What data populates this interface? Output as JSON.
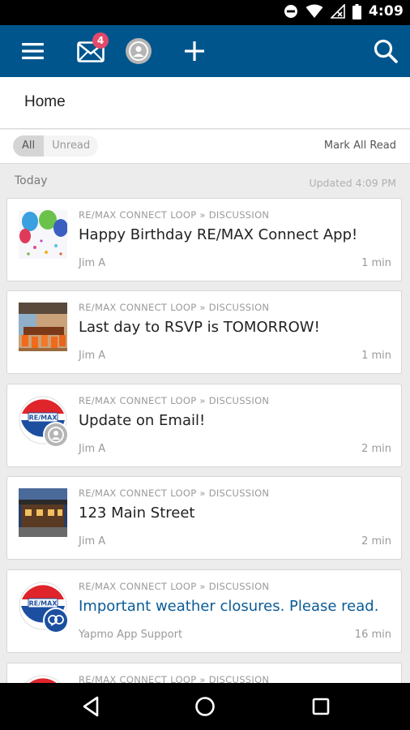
{
  "status_bar": {
    "time": "4:09"
  },
  "app_bar": {
    "notification_count": "4",
    "accent": "#00558d"
  },
  "header": {
    "title": "Home"
  },
  "filter": {
    "all_label": "All",
    "unread_label": "Unread",
    "mark_all_label": "Mark All Read"
  },
  "section": {
    "label": "Today",
    "updated": "Updated 4:09 PM"
  },
  "feed": [
    {
      "group": "RE/MAX CONNECT LOOP » DISCUSSION",
      "title": "Happy Birthday RE/MAX Connect App!",
      "author": "Jim A",
      "time": "1 min",
      "thumb": "balloons"
    },
    {
      "group": "RE/MAX CONNECT LOOP » DISCUSSION",
      "title": "Last day to RSVP is TOMORROW!",
      "author": "Jim A",
      "time": "1 min",
      "thumb": "conference-room"
    },
    {
      "group": "RE/MAX CONNECT LOOP » DISCUSSION",
      "title": "Update on Email!",
      "author": "Jim A",
      "time": "2 min",
      "thumb": "remax-balloon-user"
    },
    {
      "group": "RE/MAX CONNECT LOOP » DISCUSSION",
      "title": "123 Main Street",
      "author": "Jim A",
      "time": "2 min",
      "thumb": "house"
    },
    {
      "group": "RE/MAX CONNECT LOOP » DISCUSSION",
      "title": "Important weather closures. Please read.",
      "author": "Yapmo App Support",
      "time": "16 min",
      "thumb": "remax-balloon-support"
    },
    {
      "group": "RE/MAX CONNECT LOOP » DISCUSSION",
      "title": "",
      "author": "",
      "time": "",
      "thumb": "remax-balloon"
    }
  ]
}
